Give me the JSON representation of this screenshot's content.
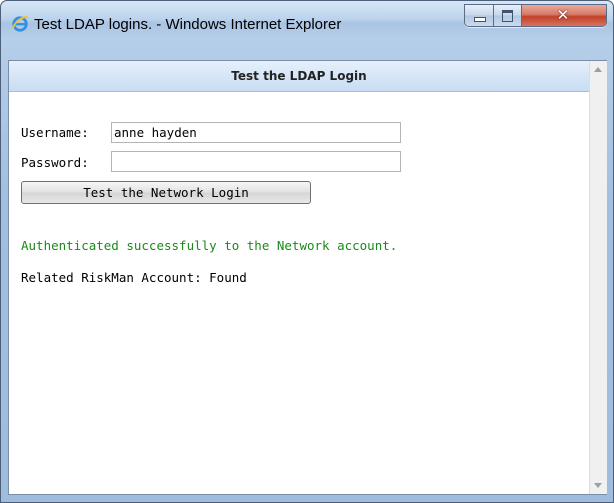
{
  "window": {
    "title": "Test LDAP logins. - Windows Internet Explorer",
    "icon": "ie-logo-icon"
  },
  "page": {
    "header": "Test the LDAP Login",
    "form": {
      "username_label": "Username:",
      "username_value": "anne hayden",
      "password_label": "Password:",
      "password_value": "",
      "submit_label": "Test the Network Login"
    },
    "status": {
      "success_message": "Authenticated successfully to the Network account.",
      "related_account": "Related RiskMan Account: Found",
      "success_color": "#1a8a1a"
    }
  }
}
